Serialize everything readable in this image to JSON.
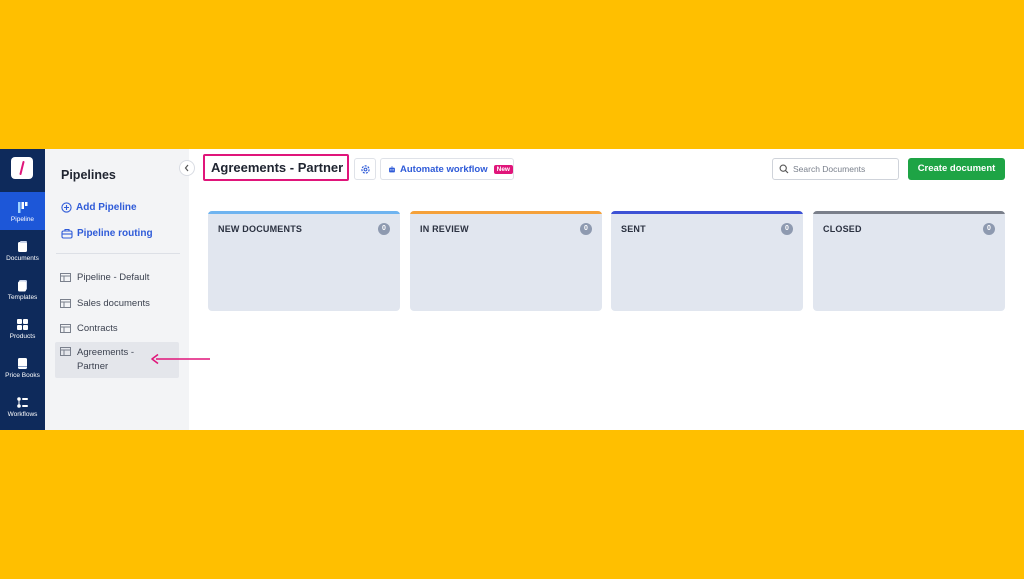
{
  "colors": {
    "background": "#FFBF00",
    "rail": "#0E2A5B",
    "rail_active": "#1D57D8",
    "accent_link": "#2F5BD8",
    "highlight": "#E0157A",
    "create": "#1EA445"
  },
  "rail": {
    "items": [
      {
        "label": "Pipeline",
        "icon": "pipeline-icon",
        "active": true
      },
      {
        "label": "Documents",
        "icon": "documents-icon"
      },
      {
        "label": "Templates",
        "icon": "templates-icon"
      },
      {
        "label": "Products",
        "icon": "products-icon"
      },
      {
        "label": "Price Books",
        "icon": "price-books-icon"
      },
      {
        "label": "Workflows",
        "icon": "workflows-icon"
      }
    ]
  },
  "panel": {
    "title": "Pipelines",
    "add_pipeline": "Add Pipeline",
    "pipeline_routing": "Pipeline routing",
    "pipelines": [
      "Pipeline - Default",
      "Sales documents",
      "Contracts",
      "Agreements - Partner"
    ],
    "selected": "Agreements - Partner"
  },
  "header": {
    "title": "Agreements - Partner",
    "automate_label": "Automate workflow",
    "new_badge": "New",
    "search_placeholder": "Search Documents",
    "create_label": "Create document"
  },
  "columns": [
    {
      "title": "NEW DOCUMENTS",
      "count": "0",
      "color": "#6FB4F0"
    },
    {
      "title": "IN REVIEW",
      "count": "0",
      "color": "#F5A13A"
    },
    {
      "title": "SENT",
      "count": "0",
      "color": "#3D52D5"
    },
    {
      "title": "CLOSED",
      "count": "0",
      "color": "#7A7F8A"
    }
  ]
}
